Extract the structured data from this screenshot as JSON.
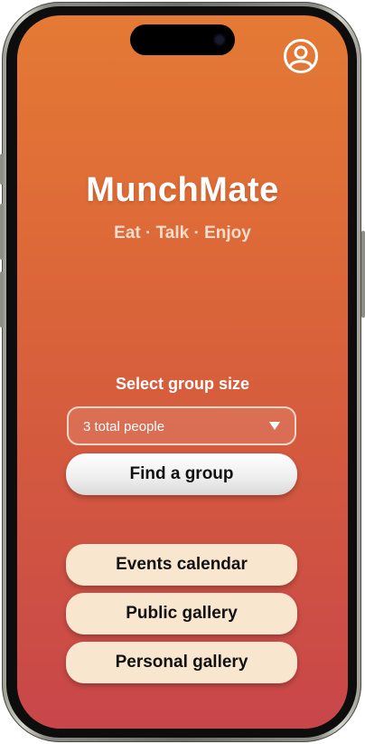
{
  "app": {
    "brand": "MunchMate",
    "tagline": "Eat · Talk · Enjoy"
  },
  "header": {
    "profile_icon": "user-circle-icon"
  },
  "group_size": {
    "label": "Select group size",
    "selected": "3 total people",
    "dropdown_icon": "caret-down-icon"
  },
  "actions": {
    "find_group": "Find a group",
    "events_calendar": "Events calendar",
    "public_gallery": "Public gallery",
    "personal_gallery": "Personal gallery"
  },
  "colors": {
    "gradient_top": "#e47a35",
    "gradient_bottom": "#c8464a",
    "cream_button": "#f9e6cf",
    "tagline": "#f7dccb"
  }
}
